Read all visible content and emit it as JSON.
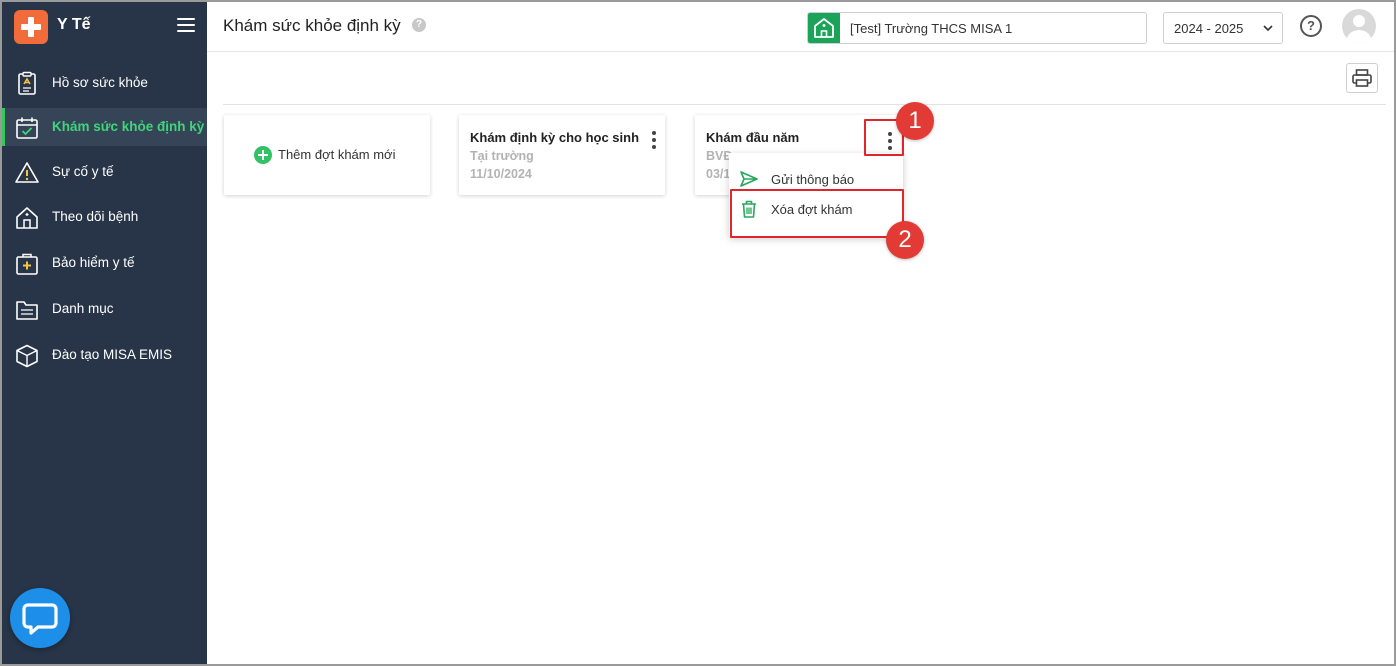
{
  "app": {
    "title": "Y Tế"
  },
  "sidebar": {
    "items": [
      {
        "label": "Hồ sơ sức khỏe",
        "icon": "health-record-icon"
      },
      {
        "label": "Khám sức khỏe định kỳ",
        "icon": "calendar-check-icon",
        "active": true
      },
      {
        "label": "Sự cố y tế",
        "icon": "warning-icon"
      },
      {
        "label": "Theo dõi bệnh",
        "icon": "house-icon"
      },
      {
        "label": "Bảo hiểm y tế",
        "icon": "insurance-icon"
      },
      {
        "label": "Danh mục",
        "icon": "folder-list-icon"
      },
      {
        "label": "Đào tạo MISA EMIS",
        "icon": "cube-icon"
      }
    ]
  },
  "header": {
    "title": "Khám sức khỏe định kỳ",
    "help": "?",
    "school": "[Test] Trường THCS MISA 1",
    "year": "2024 - 2025",
    "help_circle": "?"
  },
  "content": {
    "add_label": "Thêm đợt khám mới",
    "cards": [
      {
        "title": "Khám định kỳ cho học sinh",
        "location": "Tại trường",
        "date": "11/10/2024"
      },
      {
        "title": "Khám đầu năm",
        "location": "BVĐ",
        "date": "03/1"
      }
    ],
    "menu": [
      {
        "label": "Gửi thông báo",
        "icon": "send-icon"
      },
      {
        "label": "Xóa đợt khám",
        "icon": "trash-icon"
      }
    ]
  },
  "annotations": {
    "step1": "1",
    "step2": "2"
  },
  "colors": {
    "sidebar": "#283548",
    "accent_green": "#34c759",
    "marker_red": "#e0262c",
    "brand_orange": "#f26b3a"
  }
}
